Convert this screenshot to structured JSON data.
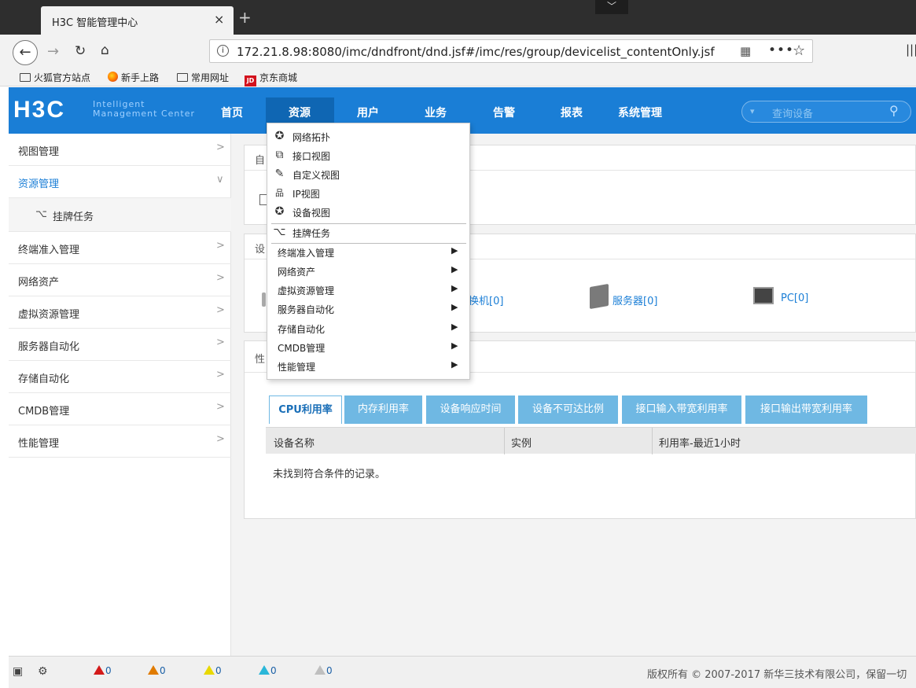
{
  "browser": {
    "tab_title": "H3C 智能管理中心",
    "tab_close": "×",
    "new_tab": "+",
    "drop_glyph": "﹀",
    "url": "172.21.8.98:8080/imc/dndfront/dnd.jsf#/imc/res/group/devicelist_contentOnly.jsf",
    "bookmarks": [
      {
        "label": "火狐官方站点",
        "icon": "folder-icon"
      },
      {
        "label": "新手上路",
        "icon": "firefox-icon"
      },
      {
        "label": "常用网址",
        "icon": "folder-icon"
      },
      {
        "label": "京东商城",
        "icon": "jd-icon",
        "icon_text": "JD"
      }
    ]
  },
  "header": {
    "logo": "H3C",
    "logo_sub1": "Intelligent",
    "logo_sub2": "Management Center",
    "menu": [
      "首页",
      "资源",
      "用户",
      "业务",
      "告警",
      "报表",
      "系统管理"
    ],
    "active_menu": "资源",
    "search_placeholder": "查询设备",
    "accent": "#1a7ed6"
  },
  "sidebar": {
    "items": [
      {
        "label": "视图管理"
      },
      {
        "label": "资源管理",
        "active": true
      },
      {
        "label": "终端准入管理"
      },
      {
        "label": "网络资产"
      },
      {
        "label": "虚拟资源管理"
      },
      {
        "label": "服务器自动化"
      },
      {
        "label": "存储自动化"
      },
      {
        "label": "CMDB管理"
      },
      {
        "label": "性能管理"
      }
    ],
    "sub_item": "挂牌任务"
  },
  "main": {
    "panel1_title": "自",
    "panel2_title": "设",
    "panel3_title": "性",
    "devices": [
      {
        "label": "换机[0]",
        "icon": "switch-icon"
      },
      {
        "label": "服务器[0]",
        "icon": "server-icon"
      },
      {
        "label": "PC[0]",
        "icon": "pc-icon"
      }
    ],
    "tabs": [
      "CPU利用率",
      "内存利用率",
      "设备响应时间",
      "设备不可达比例",
      "接口输入带宽利用率",
      "接口输出带宽利用率"
    ],
    "grid_columns": [
      "设备名称",
      "实例",
      "利用率-最近1小时"
    ],
    "empty_text": "未找到符合条件的记录。"
  },
  "dropdown": {
    "group1": [
      {
        "label": "网络拓扑",
        "icon": "topology-icon",
        "glyph": "✪"
      },
      {
        "label": "接口视图",
        "icon": "interface-view-icon",
        "glyph": "⧉"
      },
      {
        "label": "自定义视图",
        "icon": "custom-view-icon",
        "glyph": "✎"
      },
      {
        "label": "IP视图",
        "icon": "ip-view-icon",
        "glyph": "品"
      },
      {
        "label": "设备视图",
        "icon": "device-view-icon",
        "glyph": "✪"
      }
    ],
    "group2": [
      {
        "label": "挂牌任务",
        "icon": "tag-task-icon",
        "glyph": "⌥"
      }
    ],
    "group3": [
      "终端准入管理",
      "网络资产",
      "虚拟资源管理",
      "服务器自动化",
      "存储自动化",
      "CMDB管理",
      "性能管理"
    ]
  },
  "status": {
    "alarms": [
      {
        "count": "0",
        "color": "#d31a1a"
      },
      {
        "count": "0",
        "color": "#e07b00"
      },
      {
        "count": "0",
        "color": "#e8d800"
      },
      {
        "count": "0",
        "color": "#2ab7d9"
      },
      {
        "count": "0",
        "color": "#bfbfbf"
      }
    ],
    "copyright": "版权所有 © 2007-2017 新华三技术有限公司，保留一切"
  }
}
